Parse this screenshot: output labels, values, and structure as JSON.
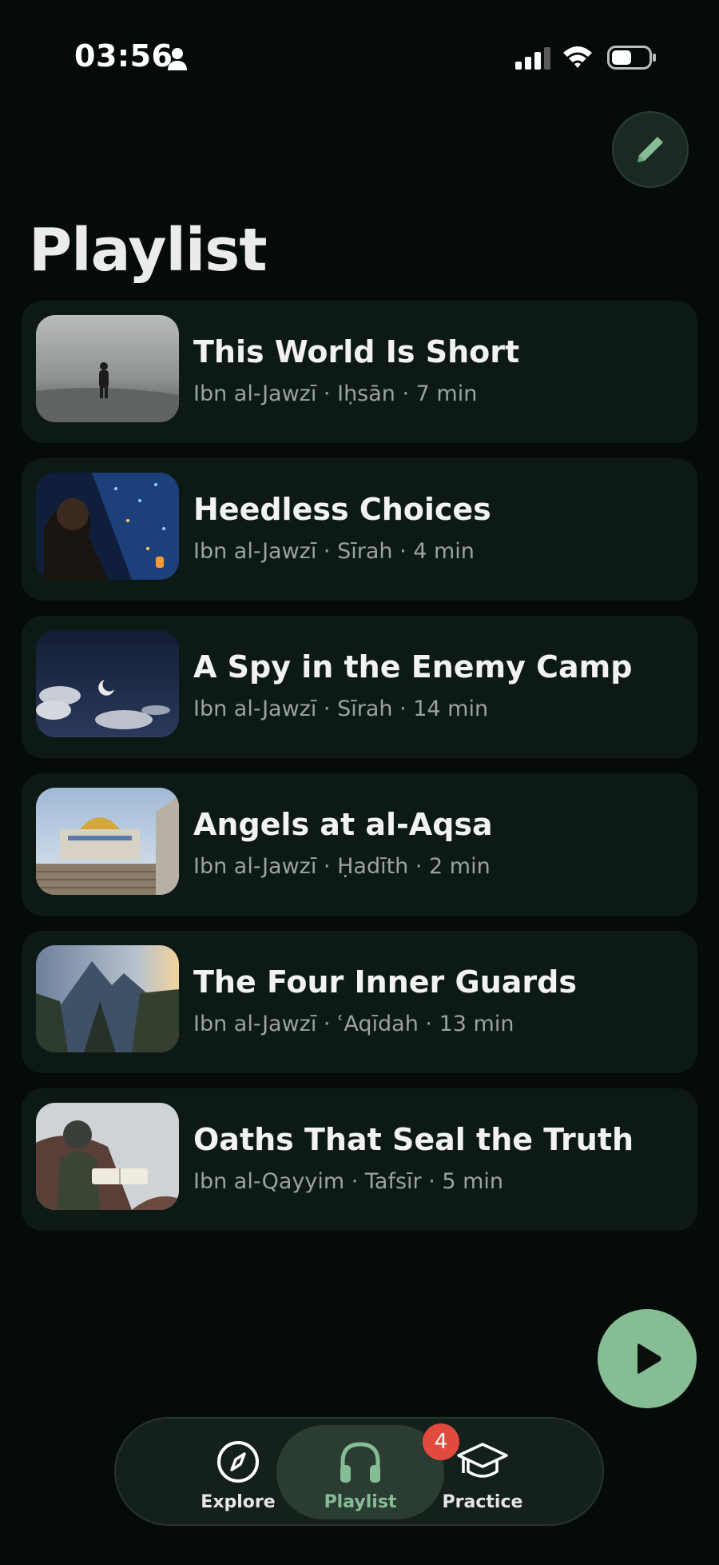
{
  "status_bar": {
    "time": "03:56"
  },
  "page": {
    "title": "Playlist"
  },
  "tracks": [
    {
      "title": "This World Is Short",
      "meta": "Ibn al-Jawzī · Iḥsān · 7 min"
    },
    {
      "title": "Heedless Choices",
      "meta": "Ibn al-Jawzī · Sīrah · 4 min"
    },
    {
      "title": "A Spy in the Enemy Camp",
      "meta": "Ibn al-Jawzī · Sīrah · 14 min"
    },
    {
      "title": "Angels at al-Aqsa",
      "meta": "Ibn al-Jawzī · Ḥadīth · 2 min"
    },
    {
      "title": "The Four Inner Guards",
      "meta": "Ibn al-Jawzī · ʿAqīdah · 13 min"
    },
    {
      "title": "Oaths That Seal the Truth",
      "meta": "Ibn al-Qayyim · Tafsīr · 5 min"
    }
  ],
  "nav": {
    "items": [
      {
        "label": "Explore",
        "icon": "compass-icon",
        "active": false
      },
      {
        "label": "Playlist",
        "icon": "headphones-icon",
        "active": true
      },
      {
        "label": "Practice",
        "icon": "graduation-cap-icon",
        "active": false
      }
    ],
    "practice_badge": "4"
  },
  "colors": {
    "background": "#040b08",
    "card": "#0d1914",
    "accent": "#86bd95",
    "badge": "#e2493f"
  }
}
